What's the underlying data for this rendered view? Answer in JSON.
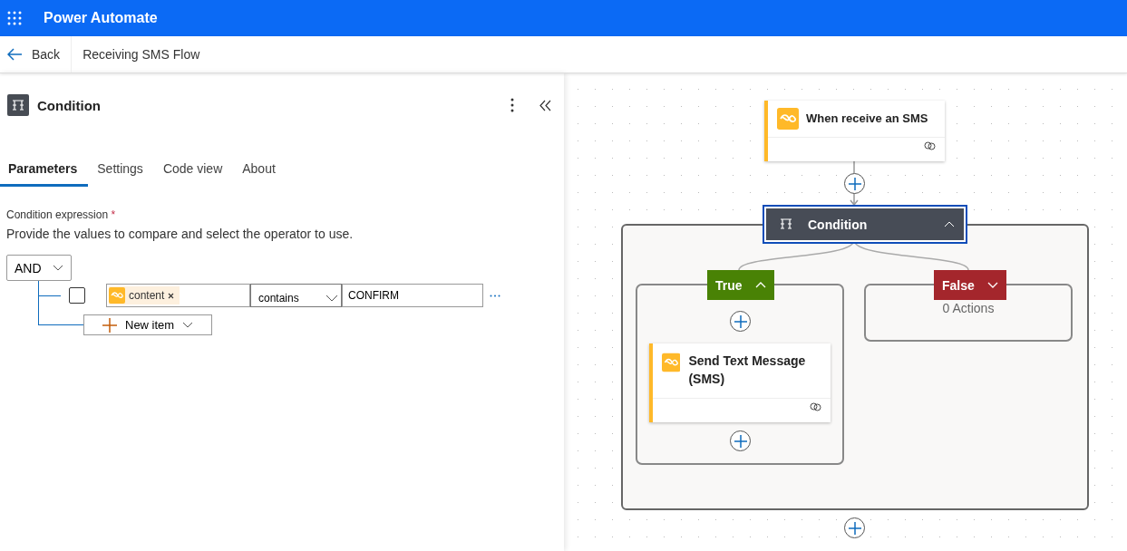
{
  "app_bar": {
    "title": "Power Automate"
  },
  "command_bar": {
    "back_label": "Back",
    "flow_name": "Receiving SMS Flow"
  },
  "panel": {
    "title": "Condition",
    "tabs": [
      {
        "label": "Parameters",
        "selected": true
      },
      {
        "label": "Settings",
        "selected": false
      },
      {
        "label": "Code view",
        "selected": false
      },
      {
        "label": "About",
        "selected": false
      }
    ],
    "field_label": "Condition expression",
    "required_mark": "*",
    "description": "Provide the values to compare and select the operator to use.",
    "group_operator": "AND",
    "rows": [
      {
        "checked": false,
        "token": "content",
        "operator": "contains",
        "value": "CONFIRM"
      }
    ],
    "new_item_label": "New item"
  },
  "canvas": {
    "trigger": {
      "title": "When receive an SMS"
    },
    "condition": {
      "title": "Condition",
      "selected": true,
      "expanded": true
    },
    "branches": [
      {
        "kind": "true",
        "label": "True",
        "expanded": true,
        "actions": [
          {
            "title": "Send Text Message (SMS)"
          }
        ]
      },
      {
        "kind": "false",
        "label": "False",
        "expanded": false,
        "empty_text": "0 Actions"
      }
    ]
  }
}
